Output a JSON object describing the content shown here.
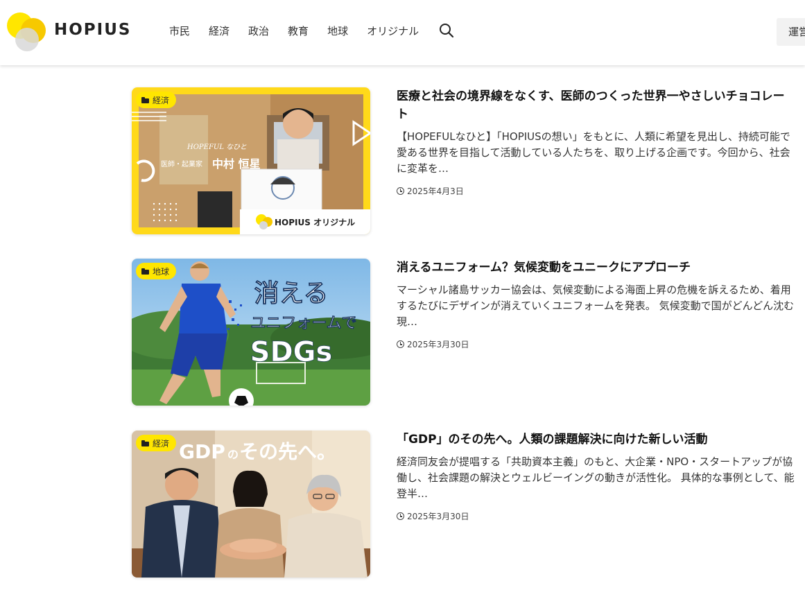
{
  "header": {
    "logo_text": "HOPIUS",
    "nav": [
      "市民",
      "経済",
      "政治",
      "教育",
      "地球",
      "オリジナル"
    ],
    "unei_label": "運営"
  },
  "articles": [
    {
      "category": "経済",
      "title": "医療と社会の境界線をなくす、医師のつくった世界一やさしいチョコレート",
      "excerpt": "【HOPEFULなひと】「HOPIUSの想い」をもとに、人類に希望を見出し、持続可能で愛ある世界を目指して活動している人たちを、取り上げる企画です。今回から、社会に変革を…",
      "date": "2025年4月3日",
      "thumb": {
        "series": "HOPEFUL なひと",
        "role": "医師・起業家",
        "name": "中村 恒星",
        "brand": "HOPIUS オリジナル"
      }
    },
    {
      "category": "地球",
      "title": "消えるユニフォーム？気候変動をユニークにアプローチ",
      "excerpt": "マーシャル諸島サッカー協会は、気候変動による海面上昇の危機を訴えるため、着用するたびにデザインが消えていくユニフォームを発表。 気候変動で国がどんどん沈む現…",
      "date": "2025年3月30日",
      "thumb": {
        "line1": "消える",
        "line2": "ユニフォームで",
        "line3": "SDGs"
      }
    },
    {
      "category": "経済",
      "title": "「GDP」のその先へ。人類の課題解決に向けた新しい活動",
      "excerpt": "経済同友会が提唱する「共助資本主義」のもと、大企業・NPO・スタートアップが協働し、社会課題の解決とウェルビーイングの動きが活性化。 具体的な事例として、能登半…",
      "date": "2025年3月30日",
      "thumb": {
        "gdp": "GDP",
        "no": "の",
        "rest": "その先へ。"
      }
    }
  ],
  "colors": {
    "accent_yellow": "#ffe600",
    "badge_text": "#333333"
  }
}
